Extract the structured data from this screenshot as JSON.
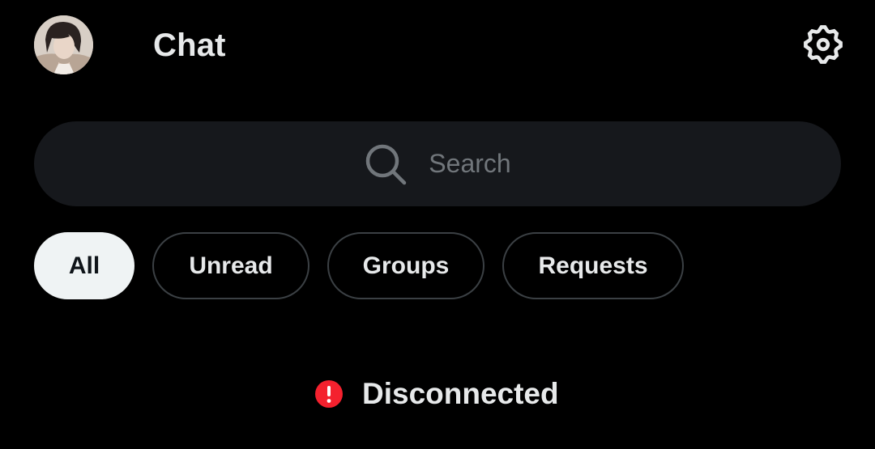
{
  "header": {
    "title": "Chat",
    "avatar_icon": "profile-avatar",
    "settings_icon": "gear-icon"
  },
  "search": {
    "placeholder": "Search",
    "icon": "search-icon"
  },
  "filters": {
    "items": [
      {
        "label": "All",
        "active": true
      },
      {
        "label": "Unread",
        "active": false
      },
      {
        "label": "Groups",
        "active": false
      },
      {
        "label": "Requests",
        "active": false
      }
    ]
  },
  "status": {
    "text": "Disconnected",
    "icon": "alert-icon",
    "color": "#f4212e"
  },
  "colors": {
    "background": "#000000",
    "text": "#e7e9ea",
    "search_bg": "#16181c",
    "placeholder": "#71767b",
    "chip_border": "#3b4044",
    "chip_active_bg": "#eff3f4"
  }
}
